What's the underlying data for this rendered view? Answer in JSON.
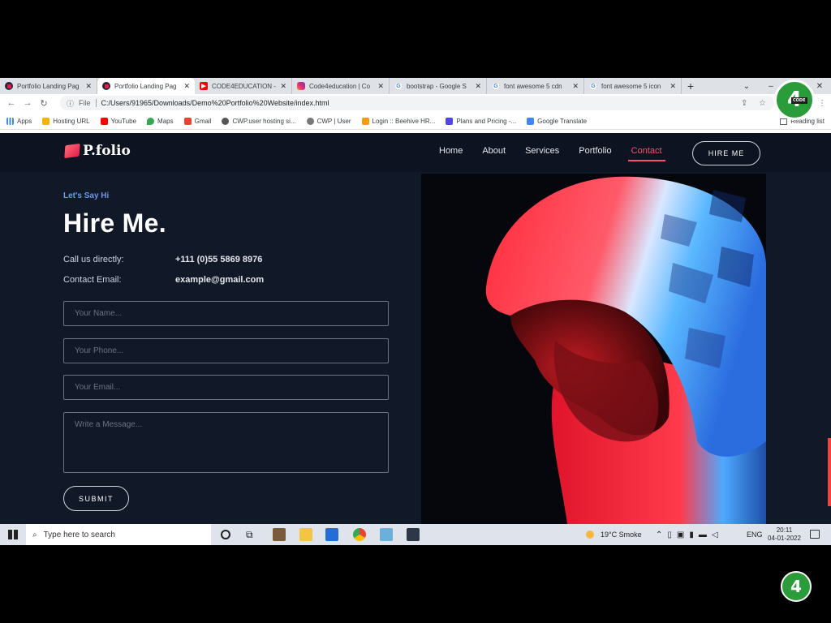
{
  "browser": {
    "tabs": [
      {
        "label": "Portfolio Landing Pag",
        "icon": "pfolio-favicon",
        "color": "#e11d48",
        "active": false
      },
      {
        "label": "Portfolio Landing Pag",
        "icon": "pfolio-favicon",
        "color": "#e11d48",
        "active": true
      },
      {
        "label": "CODE4EDUCATION -",
        "icon": "youtube-icon",
        "color": "#ff0000",
        "active": false
      },
      {
        "label": "Code4education | Co",
        "icon": "instagram-icon",
        "color": "#c13584",
        "active": false
      },
      {
        "label": "bootstrap - Google S",
        "icon": "google-icon",
        "color": "#4285f4",
        "active": false
      },
      {
        "label": "font awesome 5 cdn",
        "icon": "google-icon",
        "color": "#4285f4",
        "active": false
      },
      {
        "label": "font awesome 5 icon",
        "icon": "google-icon",
        "color": "#4285f4",
        "active": false
      }
    ],
    "address": {
      "scheme": "File",
      "url": "C:/Users/91965/Downloads/Demo%20Portfolio%20Website/index.html"
    },
    "bookmarks": [
      {
        "label": "Apps",
        "color": "#4285f4"
      },
      {
        "label": "Hosting URL",
        "color": "#f4b400"
      },
      {
        "label": "YouTube",
        "color": "#ff0000"
      },
      {
        "label": "Maps",
        "color": "#34a853"
      },
      {
        "label": "Gmail",
        "color": "#ea4335"
      },
      {
        "label": "CWP.user hosting si...",
        "color": "#555555"
      },
      {
        "label": "CWP | User",
        "color": "#777777"
      },
      {
        "label": "Login :: Beehive HR...",
        "color": "#f59e0b"
      },
      {
        "label": "Plans and Pricing -...",
        "color": "#4f46e5"
      },
      {
        "label": "Google Translate",
        "color": "#4285f4"
      }
    ],
    "reading_list": "Reading list"
  },
  "overlay_logo": {
    "glyph": "4",
    "caption": "CODE"
  },
  "site": {
    "brand": "P.folio",
    "nav": [
      {
        "label": "Home",
        "active": false
      },
      {
        "label": "About",
        "active": false
      },
      {
        "label": "Services",
        "active": false
      },
      {
        "label": "Portfolio",
        "active": false
      },
      {
        "label": "Contact",
        "active": true
      }
    ],
    "hire_button": "HIRE ME",
    "eyebrow": "Let's Say Hi",
    "headline": "Hire Me.",
    "call_label": "Call us directly:",
    "call_value": "+111 (0)55 5869 8976",
    "email_label": "Contact Email:",
    "email_value": "example@gmail.com",
    "form": {
      "name_placeholder": "Your Name...",
      "phone_placeholder": "Your Phone...",
      "email_placeholder": "Your Email...",
      "message_placeholder": "Write a Message...",
      "submit": "SUBMIT"
    },
    "accent_color": "#ff4d6d"
  },
  "taskbar": {
    "search_placeholder": "Type here to search",
    "weather": "19°C  Smoke",
    "language": "ENG",
    "time": "20:11",
    "date": "04-01-2022"
  }
}
